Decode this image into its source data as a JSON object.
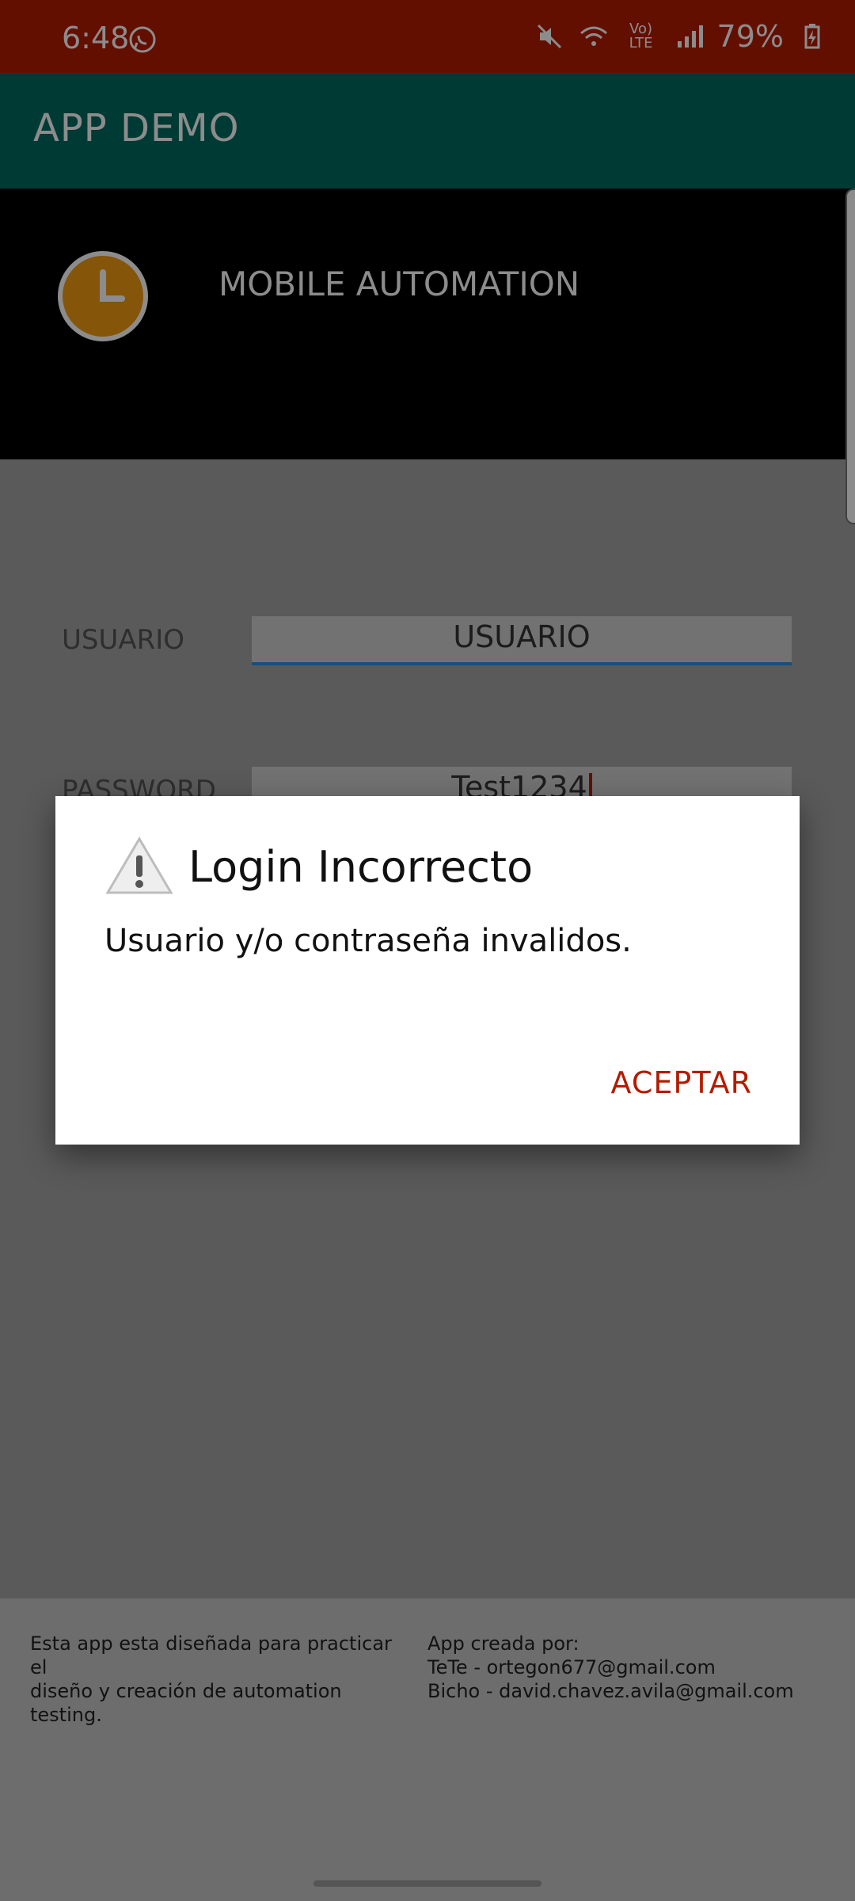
{
  "status_bar": {
    "time": "6:48",
    "battery": "79%",
    "icons": [
      "whatsapp-icon",
      "mute-icon",
      "wifi-icon",
      "volte-icon",
      "signal-icon",
      "battery-icon"
    ],
    "volte_label": "Vo) LTE"
  },
  "app": {
    "title": "APP DEMO"
  },
  "header": {
    "title": "MOBILE AUTOMATION",
    "icon": "clock-icon"
  },
  "form": {
    "username_label": "USUARIO",
    "username_value": "USUARIO",
    "password_label": "PASSWORD",
    "password_value": "Test1234"
  },
  "footer": {
    "left_line1": "Esta app esta diseñada para practicar el",
    "left_line2": "diseño y creación de automation testing.",
    "right_line1": "App creada por:",
    "right_line2": "TeTe - ortegon677@gmail.com",
    "right_line3": "Bicho - david.chavez.avila@gmail.com"
  },
  "dialog": {
    "title": "Login Incorrecto",
    "message": "Usuario y/o contraseña invalidos.",
    "accept_label": "ACEPTAR",
    "icon": "warning-icon"
  },
  "colors": {
    "status_bar": "#b41c00",
    "app_bar": "#006a60",
    "header": "#000000",
    "accent_text": "#b41c00",
    "field_underline": "#2b91e6"
  }
}
